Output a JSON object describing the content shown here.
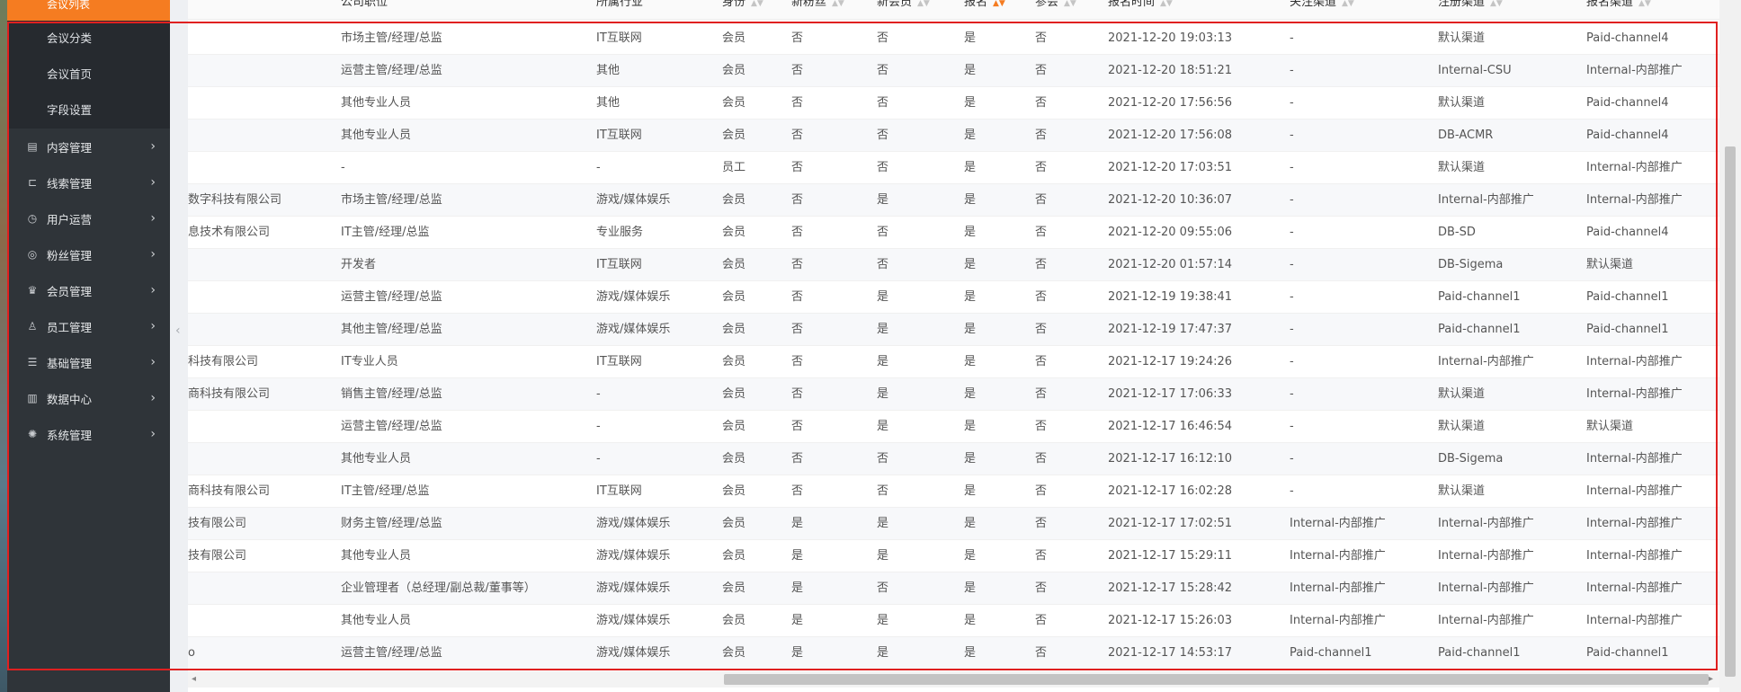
{
  "sidebar": {
    "active_item": "会议列表",
    "sub_items": [
      "会议分类",
      "会议首页",
      "字段设置"
    ],
    "groups": [
      {
        "label": "内容管理",
        "icon": "document-icon",
        "glyph": "▤"
      },
      {
        "label": "线索管理",
        "icon": "tree-icon",
        "glyph": "⊏"
      },
      {
        "label": "用户运营",
        "icon": "clock-icon",
        "glyph": "◷"
      },
      {
        "label": "粉丝管理",
        "icon": "target-icon",
        "glyph": "◎"
      },
      {
        "label": "会员管理",
        "icon": "crown-icon",
        "glyph": "♛"
      },
      {
        "label": "员工管理",
        "icon": "person-icon",
        "glyph": "♙"
      },
      {
        "label": "基础管理",
        "icon": "database-icon",
        "glyph": "☰"
      },
      {
        "label": "数据中心",
        "icon": "bar-chart-icon",
        "glyph": "▥"
      },
      {
        "label": "系统管理",
        "icon": "palette-icon",
        "glyph": "✺"
      }
    ],
    "chevron": "›",
    "collapse_handle": "‹"
  },
  "table": {
    "headers": [
      "公司职位",
      "所属行业",
      "身份",
      "新粉丝",
      "新会员",
      "报名",
      "参会",
      "报名时间",
      "关注渠道",
      "注册渠道",
      "报名渠道"
    ],
    "rows": [
      {
        "company": "",
        "position": "市场主管/经理/总监",
        "industry": "IT互联网",
        "identity": "会员",
        "new_fan": "否",
        "new_member": "否",
        "signup": "是",
        "attend": "否",
        "time": "2021-12-20 19:03:13",
        "follow": "-",
        "register": "默认渠道",
        "signup_channel": "Paid-channel4"
      },
      {
        "company": "",
        "position": "运营主管/经理/总监",
        "industry": "其他",
        "identity": "会员",
        "new_fan": "否",
        "new_member": "否",
        "signup": "是",
        "attend": "否",
        "time": "2021-12-20 18:51:21",
        "follow": "-",
        "register": "Internal-CSU",
        "signup_channel": "Internal-内部推广"
      },
      {
        "company": "",
        "position": "其他专业人员",
        "industry": "其他",
        "identity": "会员",
        "new_fan": "否",
        "new_member": "否",
        "signup": "是",
        "attend": "否",
        "time": "2021-12-20 17:56:56",
        "follow": "-",
        "register": "默认渠道",
        "signup_channel": "Paid-channel4"
      },
      {
        "company": "",
        "position": "其他专业人员",
        "industry": "IT互联网",
        "identity": "会员",
        "new_fan": "否",
        "new_member": "否",
        "signup": "是",
        "attend": "否",
        "time": "2021-12-20 17:56:08",
        "follow": "-",
        "register": "DB-ACMR",
        "signup_channel": "Paid-channel4"
      },
      {
        "company": "",
        "position": "-",
        "industry": "-",
        "identity": "员工",
        "new_fan": "否",
        "new_member": "否",
        "signup": "是",
        "attend": "否",
        "time": "2021-12-20 17:03:51",
        "follow": "-",
        "register": "默认渠道",
        "signup_channel": "Internal-内部推广"
      },
      {
        "company": "数字科技有限公司",
        "position": "市场主管/经理/总监",
        "industry": "游戏/媒体娱乐",
        "identity": "会员",
        "new_fan": "否",
        "new_member": "是",
        "signup": "是",
        "attend": "否",
        "time": "2021-12-20 10:36:07",
        "follow": "-",
        "register": "Internal-内部推广",
        "signup_channel": "Internal-内部推广"
      },
      {
        "company": "息技术有限公司",
        "position": "IT主管/经理/总监",
        "industry": "专业服务",
        "identity": "会员",
        "new_fan": "否",
        "new_member": "否",
        "signup": "是",
        "attend": "否",
        "time": "2021-12-20 09:55:06",
        "follow": "-",
        "register": "DB-SD",
        "signup_channel": "Paid-channel4"
      },
      {
        "company": "",
        "position": "开发者",
        "industry": "IT互联网",
        "identity": "会员",
        "new_fan": "否",
        "new_member": "否",
        "signup": "是",
        "attend": "否",
        "time": "2021-12-20 01:57:14",
        "follow": "-",
        "register": "DB-Sigema",
        "signup_channel": "默认渠道"
      },
      {
        "company": "",
        "position": "运营主管/经理/总监",
        "industry": "游戏/媒体娱乐",
        "identity": "会员",
        "new_fan": "否",
        "new_member": "是",
        "signup": "是",
        "attend": "否",
        "time": "2021-12-19 19:38:41",
        "follow": "-",
        "register": "Paid-channel1",
        "signup_channel": "Paid-channel1"
      },
      {
        "company": "",
        "position": "其他主管/经理/总监",
        "industry": "游戏/媒体娱乐",
        "identity": "会员",
        "new_fan": "否",
        "new_member": "是",
        "signup": "是",
        "attend": "否",
        "time": "2021-12-19 17:47:37",
        "follow": "-",
        "register": "Paid-channel1",
        "signup_channel": "Paid-channel1"
      },
      {
        "company": "科技有限公司",
        "position": "IT专业人员",
        "industry": "IT互联网",
        "identity": "会员",
        "new_fan": "否",
        "new_member": "是",
        "signup": "是",
        "attend": "否",
        "time": "2021-12-17 19:24:26",
        "follow": "-",
        "register": "Internal-内部推广",
        "signup_channel": "Internal-内部推广"
      },
      {
        "company": "商科技有限公司",
        "position": "销售主管/经理/总监",
        "industry": "-",
        "identity": "会员",
        "new_fan": "否",
        "new_member": "是",
        "signup": "是",
        "attend": "否",
        "time": "2021-12-17 17:06:33",
        "follow": "-",
        "register": "默认渠道",
        "signup_channel": "Internal-内部推广"
      },
      {
        "company": "",
        "position": "运营主管/经理/总监",
        "industry": "-",
        "identity": "会员",
        "new_fan": "否",
        "new_member": "是",
        "signup": "是",
        "attend": "否",
        "time": "2021-12-17 16:46:54",
        "follow": "-",
        "register": "默认渠道",
        "signup_channel": "默认渠道"
      },
      {
        "company": "",
        "position": "其他专业人员",
        "industry": "-",
        "identity": "会员",
        "new_fan": "否",
        "new_member": "否",
        "signup": "是",
        "attend": "否",
        "time": "2021-12-17 16:12:10",
        "follow": "-",
        "register": "DB-Sigema",
        "signup_channel": "Internal-内部推广"
      },
      {
        "company": "商科技有限公司",
        "position": "IT主管/经理/总监",
        "industry": "IT互联网",
        "identity": "会员",
        "new_fan": "否",
        "new_member": "否",
        "signup": "是",
        "attend": "否",
        "time": "2021-12-17 16:02:28",
        "follow": "-",
        "register": "默认渠道",
        "signup_channel": "Internal-内部推广"
      },
      {
        "company": "技有限公司",
        "position": "财务主管/经理/总监",
        "industry": "游戏/媒体娱乐",
        "identity": "会员",
        "new_fan": "是",
        "new_member": "是",
        "signup": "是",
        "attend": "否",
        "time": "2021-12-17 17:02:51",
        "follow": "Internal-内部推广",
        "register": "Internal-内部推广",
        "signup_channel": "Internal-内部推广"
      },
      {
        "company": "技有限公司",
        "position": "其他专业人员",
        "industry": "游戏/媒体娱乐",
        "identity": "会员",
        "new_fan": "是",
        "new_member": "是",
        "signup": "是",
        "attend": "否",
        "time": "2021-12-17 15:29:11",
        "follow": "Internal-内部推广",
        "register": "Internal-内部推广",
        "signup_channel": "Internal-内部推广"
      },
      {
        "company": "",
        "position": "企业管理者（总经理/副总裁/董事等）",
        "industry": "游戏/媒体娱乐",
        "identity": "会员",
        "new_fan": "是",
        "new_member": "否",
        "signup": "是",
        "attend": "否",
        "time": "2021-12-17 15:28:42",
        "follow": "Internal-内部推广",
        "register": "Internal-内部推广",
        "signup_channel": "Internal-内部推广"
      },
      {
        "company": "",
        "position": "其他专业人员",
        "industry": "游戏/媒体娱乐",
        "identity": "会员",
        "new_fan": "是",
        "new_member": "是",
        "signup": "是",
        "attend": "否",
        "time": "2021-12-17 15:26:03",
        "follow": "Internal-内部推广",
        "register": "Internal-内部推广",
        "signup_channel": "Internal-内部推广"
      },
      {
        "company": "o",
        "position": "运营主管/经理/总监",
        "industry": "游戏/媒体娱乐",
        "identity": "会员",
        "new_fan": "是",
        "new_member": "是",
        "signup": "是",
        "attend": "否",
        "time": "2021-12-17 14:53:17",
        "follow": "Paid-channel1",
        "register": "Paid-channel1",
        "signup_channel": "Paid-channel1"
      }
    ]
  },
  "colors": {
    "sidebar_bg": "#2f3439",
    "active_accent": "#f57c21",
    "highlight_border": "#e02020"
  }
}
